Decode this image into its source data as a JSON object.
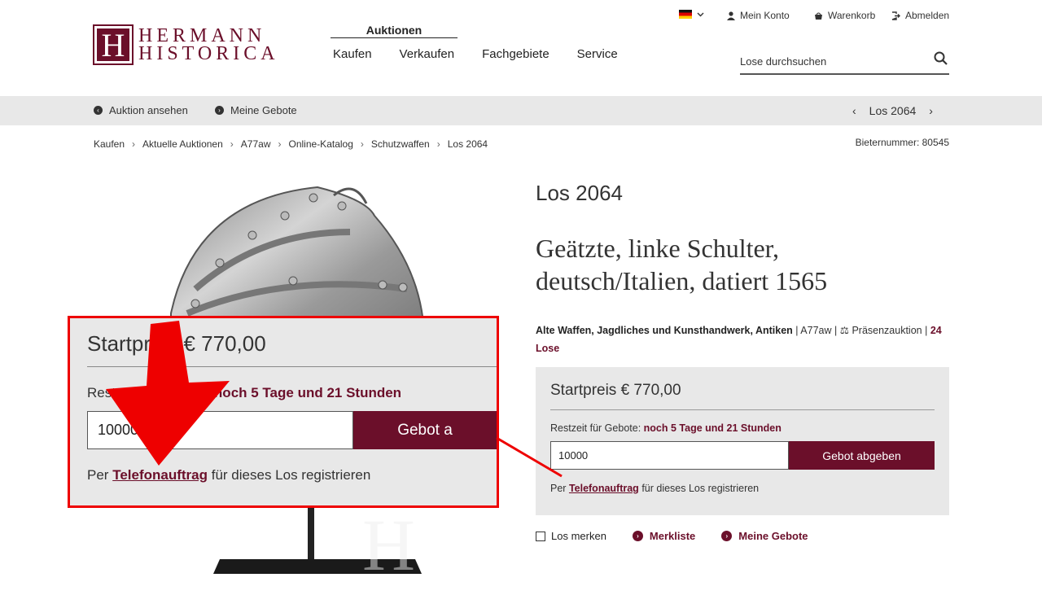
{
  "header": {
    "logo_line1": "HERMANN",
    "logo_line2": "HISTORICA",
    "logo_letter": "H",
    "top_nav_active": "Auktionen",
    "main_nav": [
      "Kaufen",
      "Verkaufen",
      "Fachgebiete",
      "Service"
    ],
    "util": {
      "mein_konto": "Mein Konto",
      "warenkorb": "Warenkorb",
      "abmelden": "Abmelden"
    },
    "search_placeholder": "Lose durchsuchen"
  },
  "subbar": {
    "auktion_ansehen": "Auktion ansehen",
    "meine_gebote": "Meine Gebote",
    "los": "Los 2064"
  },
  "breadcrumb": [
    "Kaufen",
    "Aktuelle Auktionen",
    "A77aw",
    "Online-Katalog",
    "Schutzwaffen",
    "Los 2064"
  ],
  "bieternummer": "Bieternummer: 80545",
  "product": {
    "los_title": "Los 2064",
    "title": "Geätzte, linke Schulter, deutsch/Italien, datiert 1565",
    "category": "Alte Waffen, Jagdliches und Kunsthandwerk, Antiken",
    "auction": "A77aw",
    "auction_type": "Präsenzauktion",
    "lose_count": "24 Lose"
  },
  "bid": {
    "startpreis": "Startpreis € 770,00",
    "restzeit_label": "Restzeit für Gebote:",
    "restzeit_value": "noch 5 Tage und 21 Stunden",
    "input_value": "10000",
    "button_label": "Gebot abgeben",
    "phone_prefix": "Per",
    "phone_link": "Telefonauftrag",
    "phone_suffix": "für dieses Los registrieren"
  },
  "actions": {
    "los_merken": "Los merken",
    "merkliste": "Merkliste",
    "meine_gebote": "Meine Gebote"
  },
  "zoom": {
    "startpreis": "Startpreis € 770,00",
    "restzeit_label": "Restzeit für Gebote:",
    "restzeit_value": "noch 5 Tage und 21 Stunden",
    "input_value": "10000",
    "button_label": "Gebot a",
    "phone_prefix": "Per",
    "phone_link": "Telefonauftrag",
    "phone_suffix": "für dieses Los registrieren"
  },
  "colors": {
    "accent": "#6b0f2a",
    "highlight": "#ee0000"
  }
}
